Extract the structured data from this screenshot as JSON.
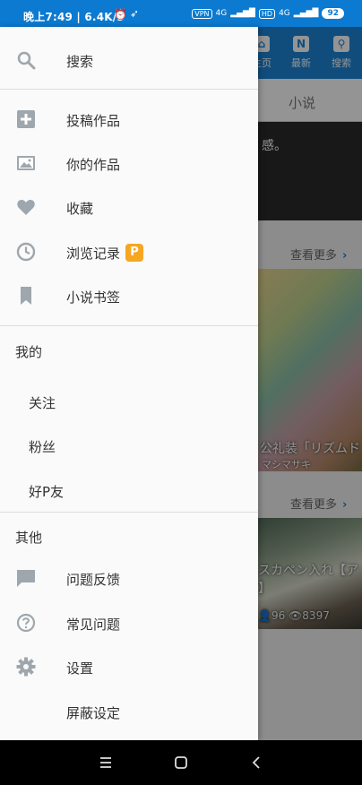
{
  "status_bar": {
    "time_speed": "晚上7:49 | 6.4K/s",
    "vpn": "VPN",
    "hd": "HD",
    "signal1": "4G",
    "signal2": "4G",
    "battery": "92"
  },
  "drawer": {
    "search_label": "搜索",
    "items": [
      {
        "label": "投稿作品",
        "icon": "add-box-icon"
      },
      {
        "label": "你的作品",
        "icon": "image-icon"
      },
      {
        "label": "收藏",
        "icon": "heart-icon"
      },
      {
        "label": "浏览记录",
        "icon": "clock-icon",
        "badge": "P"
      },
      {
        "label": "小说书签",
        "icon": "bookmark-icon"
      }
    ],
    "my_section_title": "我的",
    "my_items": [
      "关注",
      "粉丝",
      "好P友"
    ],
    "other_section_title": "其他",
    "other_items": [
      {
        "label": "问题反馈",
        "icon": "chat-icon"
      },
      {
        "label": "常见问题",
        "icon": "help-icon"
      },
      {
        "label": "设置",
        "icon": "gear-icon"
      },
      {
        "label": "屏蔽设定",
        "icon": ""
      }
    ]
  },
  "background": {
    "nav_home": "主页",
    "nav_new": "最新",
    "nav_new_glyph": "N",
    "nav_search": "搜索",
    "tab_novel": "小说",
    "dark_text": "感。",
    "see_more_1": "查看更多",
    "see_more_2": "查看更多",
    "card1_caption": "公礼装「リズムド",
    "card1_author": "マシマサキ",
    "card2_caption": "スカペン入れ【ア",
    "card2_caption2": "】",
    "card2_likes": "96",
    "card2_views": "8397"
  },
  "colors": {
    "status_bar": "#0b7ad0",
    "app_bar": "#1c86d8",
    "drawer_bg": "#fafafa",
    "icon_gray": "#9ea7ad",
    "badge_orange": "#f5a623"
  }
}
